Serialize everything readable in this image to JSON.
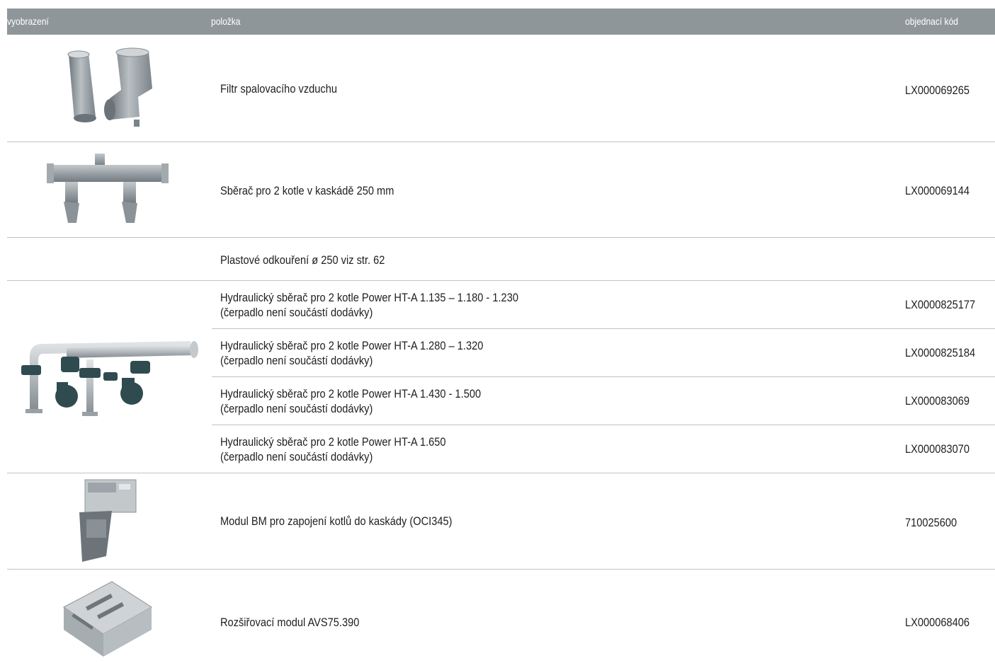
{
  "table": {
    "headers": {
      "image": "vyobrazení",
      "item": "položka",
      "code": "objednací kód"
    },
    "rows": [
      {
        "item": "Filtr spalovacího vzduchu",
        "code": "LX000069265",
        "image_icon": "air-filter-pipes-icon"
      },
      {
        "item": "Sběrač pro 2 kotle v kaskádě 250 mm",
        "code": "LX000069144",
        "image_icon": "cascade-collector-icon"
      },
      {
        "item": "Plastové odkouření ø 250 viz str. 62",
        "code": ""
      },
      {
        "item_line1": "Hydraulický sběrač pro 2 kotle Power HT-A 1.135 – 1.180 - 1.230",
        "item_line2": "(čerpadlo není součástí dodávky)",
        "code": "LX0000825177",
        "image_icon": "hydraulic-manifold-icon"
      },
      {
        "item_line1": "Hydraulický sběrač pro 2 kotle Power HT-A 1.280 – 1.320",
        "item_line2": "(čerpadlo není součástí dodávky)",
        "code": "LX0000825184"
      },
      {
        "item_line1": "Hydraulický sběrač pro 2 kotle Power HT-A 1.430 - 1.500",
        "item_line2": "(čerpadlo není součástí dodávky)",
        "code": "LX000083069"
      },
      {
        "item_line1": "Hydraulický sběrač pro 2 kotle Power HT-A 1.650",
        "item_line2": "(čerpadlo není součástí dodávky)",
        "code": "LX000083070"
      },
      {
        "item": "Modul BM pro zapojení kotlů do kaskády (OCI345)",
        "code": "710025600",
        "image_icon": "bm-module-icon"
      },
      {
        "item": "Rozšiřovací modul AVS75.390",
        "code": "LX000068406",
        "image_icon": "expansion-module-board-icon"
      }
    ]
  }
}
